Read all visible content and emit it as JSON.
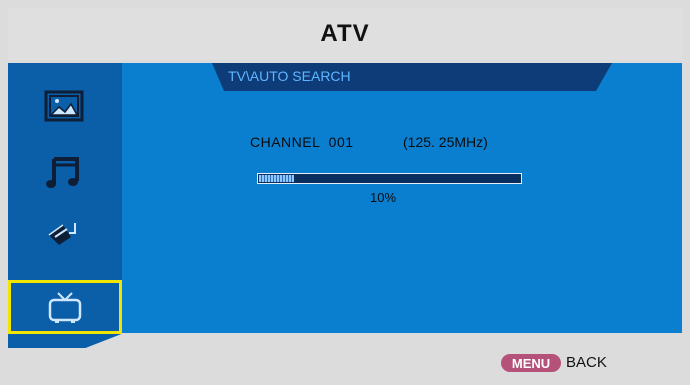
{
  "header": {
    "title": "ATV"
  },
  "sidebar": {
    "items": [
      {
        "icon": "picture-icon"
      },
      {
        "icon": "music-icon"
      },
      {
        "icon": "setup-pen-icon"
      },
      {
        "icon": "tv-icon",
        "selected": true
      }
    ]
  },
  "main": {
    "tab_title": "TV\\AUTO SEARCH",
    "channel_label": "CHANNEL  001",
    "frequency": "(125. 25MHz)",
    "progress_fraction": 0.1,
    "progress_text": "10%"
  },
  "footer": {
    "menu_key": "MENU",
    "back_label": "BACK"
  }
}
